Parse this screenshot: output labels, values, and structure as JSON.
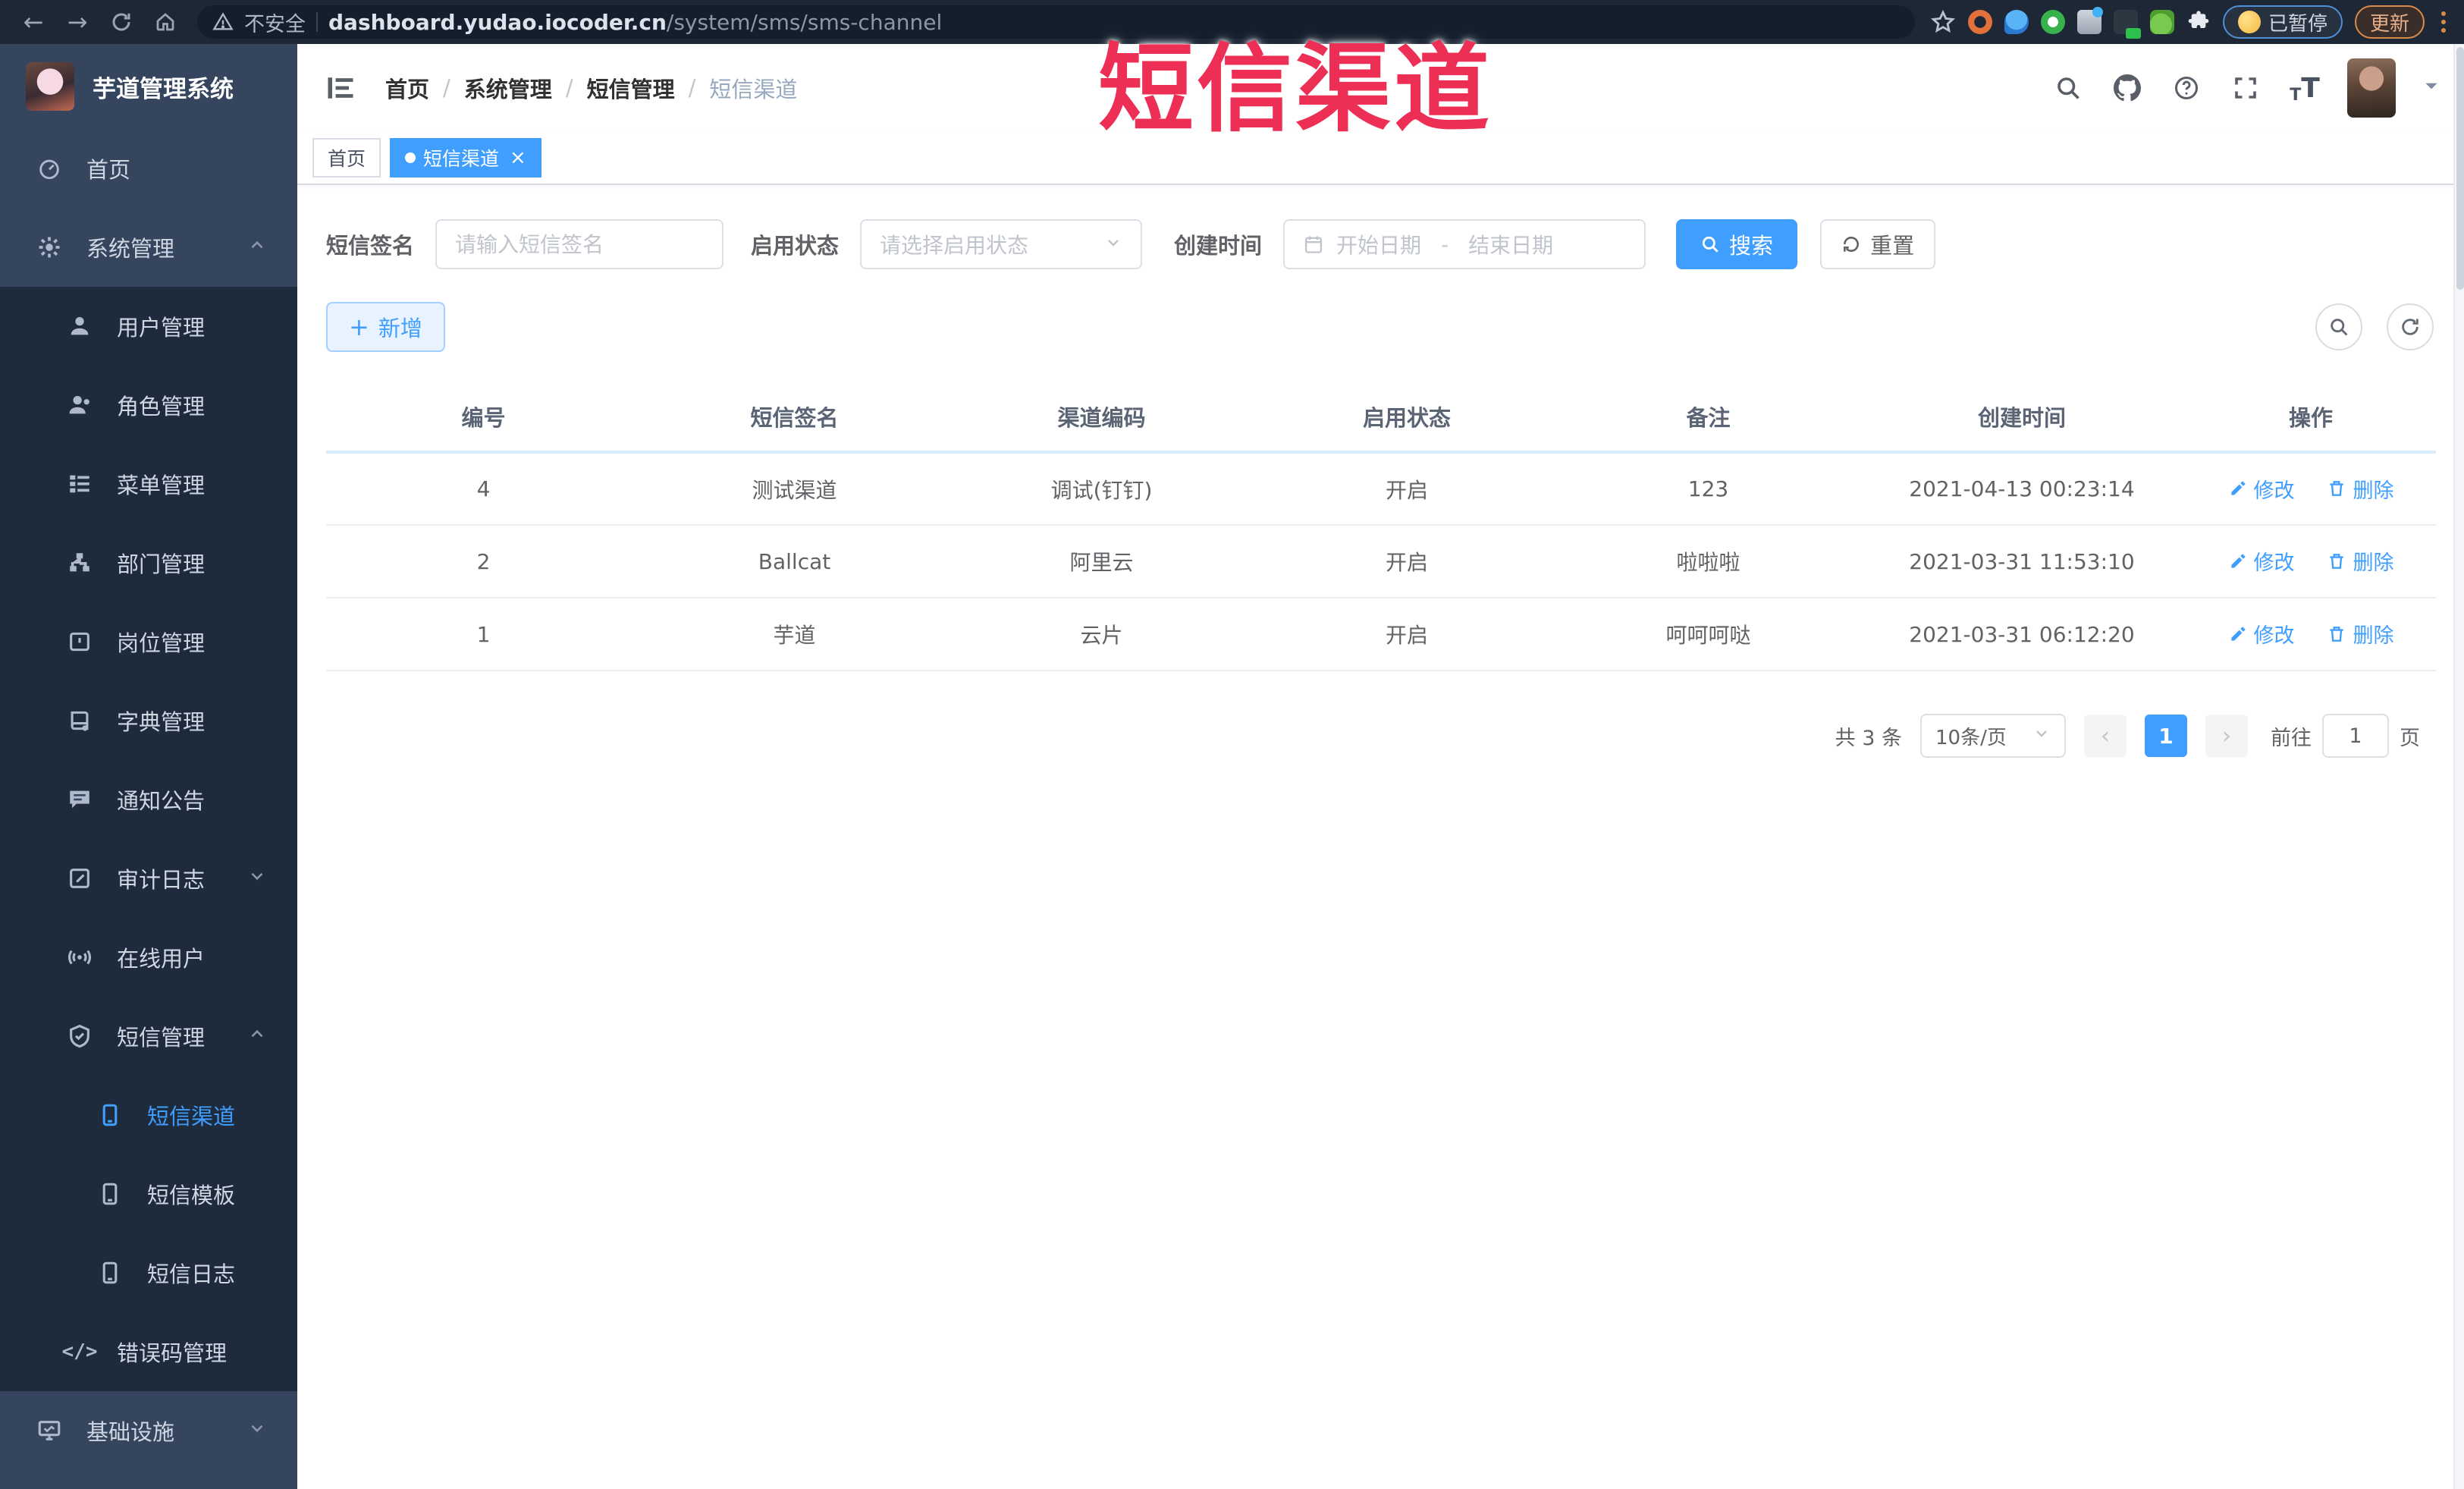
{
  "browser": {
    "security_label": "不安全",
    "url_domain": "dashboard.yudao.iocoder.cn",
    "url_path": "/system/sms/sms-channel",
    "paused_label": "已暂停",
    "update_label": "更新"
  },
  "watermark": {
    "text": "短信渠道",
    "color": "#EE2F55"
  },
  "sidebar": {
    "logo_title": "芋道管理系统",
    "items": [
      {
        "label": "首页"
      },
      {
        "label": "系统管理"
      },
      {
        "label": "用户管理"
      },
      {
        "label": "角色管理"
      },
      {
        "label": "菜单管理"
      },
      {
        "label": "部门管理"
      },
      {
        "label": "岗位管理"
      },
      {
        "label": "字典管理"
      },
      {
        "label": "通知公告"
      },
      {
        "label": "审计日志"
      },
      {
        "label": "在线用户"
      },
      {
        "label": "短信管理"
      },
      {
        "label": "短信渠道"
      },
      {
        "label": "短信模板"
      },
      {
        "label": "短信日志"
      },
      {
        "label": "错误码管理"
      },
      {
        "label": "基础设施"
      }
    ]
  },
  "header": {
    "breadcrumb": [
      "首页",
      "系统管理",
      "短信管理",
      "短信渠道"
    ]
  },
  "tabs": [
    {
      "label": "首页"
    },
    {
      "label": "短信渠道"
    }
  ],
  "filters": {
    "signature_label": "短信签名",
    "signature_placeholder": "请输入短信签名",
    "status_label": "启用状态",
    "status_placeholder": "请选择启用状态",
    "time_label": "创建时间",
    "start_placeholder": "开始日期",
    "range_separator": "-",
    "end_placeholder": "结束日期",
    "search_label": "搜索",
    "reset_label": "重置"
  },
  "toolbar": {
    "add_label": "新增"
  },
  "table": {
    "headers": [
      "编号",
      "短信签名",
      "渠道编码",
      "启用状态",
      "备注",
      "创建时间",
      "操作"
    ],
    "edit_label": "修改",
    "delete_label": "删除",
    "rows": [
      {
        "id": "4",
        "signature": "测试渠道",
        "code": "调试(钉钉)",
        "status": "开启",
        "remark": "123",
        "created": "2021-04-13 00:23:14"
      },
      {
        "id": "2",
        "signature": "Ballcat",
        "code": "阿里云",
        "status": "开启",
        "remark": "啦啦啦",
        "created": "2021-03-31 11:53:10"
      },
      {
        "id": "1",
        "signature": "芋道",
        "code": "云片",
        "status": "开启",
        "remark": "呵呵呵哒",
        "created": "2021-03-31 06:12:20"
      }
    ]
  },
  "pagination": {
    "total_label": "共 3 条",
    "page_size_label": "10条/页",
    "current_page": "1",
    "jump_prefix": "前往",
    "jump_value": "1",
    "jump_suffix": "页"
  },
  "colors": {
    "accent": "#409EFF",
    "watermark": "#EE2F55",
    "sidebar_bg": "#36455E",
    "submenu_bg": "#1D2B3D"
  }
}
